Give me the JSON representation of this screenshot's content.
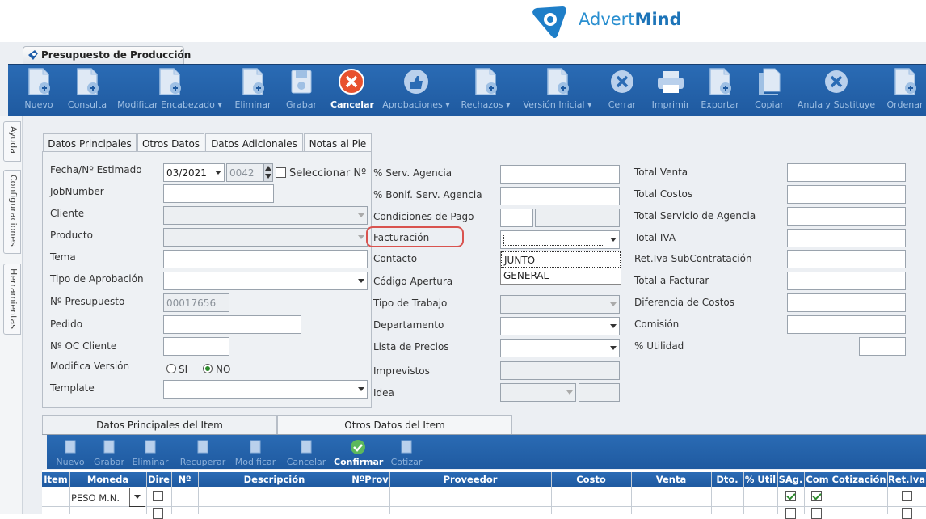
{
  "brand": {
    "name_light": "Advert",
    "name_bold": "Mind"
  },
  "document_tab": "Presupuesto de Producción",
  "toolbar": [
    {
      "icon": "new-document-icon",
      "label": "Nuevo",
      "active": false
    },
    {
      "icon": "query-document-icon",
      "label": "Consulta",
      "active": false
    },
    {
      "icon": "edit-header-icon",
      "label": "Modificar Encabezado ▾",
      "active": false
    },
    {
      "icon": "delete-document-icon",
      "label": "Eliminar",
      "active": false
    },
    {
      "icon": "save-icon",
      "label": "Grabar",
      "active": false
    },
    {
      "icon": "cancel-icon",
      "label": "Cancelar",
      "active": true
    },
    {
      "icon": "approve-icon",
      "label": "Aprobaciones ▾",
      "active": false
    },
    {
      "icon": "reject-icon",
      "label": "Rechazos ▾",
      "active": false
    },
    {
      "icon": "initial-version-icon",
      "label": "Versión Inicial ▾",
      "active": false
    },
    {
      "icon": "close-icon",
      "label": "Cerrar",
      "active": false
    },
    {
      "icon": "print-icon",
      "label": "Imprimir",
      "active": false
    },
    {
      "icon": "export-icon",
      "label": "Exportar",
      "active": false
    },
    {
      "icon": "copy-icon",
      "label": "Copiar",
      "active": false
    },
    {
      "icon": "annul-replace-icon",
      "label": "Anula y Sustituye",
      "active": false
    },
    {
      "icon": "sort-icon",
      "label": "Ordenar",
      "active": false
    }
  ],
  "side_tabs": [
    "Ayuda",
    "Configuraciones",
    "Herramientas"
  ],
  "form_tabs": [
    "Datos Principales",
    "Otros Datos",
    "Datos Adicionales",
    "Notas al Pie"
  ],
  "left_fields": {
    "fecha_label": "Fecha/Nº Estimado",
    "fecha_value": "03/2021",
    "numero_value": "0042",
    "seleccionar_label": "Seleccionar Nº",
    "jobnumber_label": "JobNumber",
    "cliente_label": "Cliente",
    "producto_label": "Producto",
    "tema_label": "Tema",
    "tipo_aprob_label": "Tipo de Aprobación",
    "presupuesto_label": "Nº Presupuesto",
    "presupuesto_value": "00017656",
    "pedido_label": "Pedido",
    "oc_label": "Nº OC Cliente",
    "modifica_label": "Modifica Versión",
    "si_label": "SI",
    "no_label": "NO",
    "template_label": "Template"
  },
  "mid_fields": {
    "serv_agencia": "% Serv. Agencia",
    "bonif": "% Bonif. Serv. Agencia",
    "condiciones": "Condiciones de Pago",
    "facturacion": "Facturación",
    "contacto": "Contacto",
    "codigo": "Código Apertura",
    "tipo_trabajo": "Tipo de Trabajo",
    "departamento": "Departamento",
    "lista_precios": "Lista de Precios",
    "imprevistos": "Imprevistos",
    "idea": "Idea"
  },
  "facturacion_options": [
    "JUNTO",
    "GENERAL"
  ],
  "right_fields": {
    "total_venta": "Total Venta",
    "total_costos": "Total Costos",
    "total_servicio": "Total Servicio de Agencia",
    "total_iva": "Total IVA",
    "ret_iva": "Ret.Iva SubContratación",
    "total_facturar": "Total a Facturar",
    "diferencia": "Diferencia de Costos",
    "comision": "Comisión",
    "utilidad": "% Utilidad"
  },
  "item_tabs": [
    "Datos Principales del Item",
    "Otros Datos del Item"
  ],
  "item_toolbar": [
    {
      "icon": "new-item-icon",
      "label": "Nuevo",
      "active": false
    },
    {
      "icon": "save-item-icon",
      "label": "Grabar",
      "active": false
    },
    {
      "icon": "delete-item-icon",
      "label": "Eliminar",
      "active": false
    },
    {
      "icon": "recover-item-icon",
      "label": "Recuperar",
      "active": false
    },
    {
      "icon": "modify-item-icon",
      "label": "Modificar",
      "active": false
    },
    {
      "icon": "cancel-item-icon",
      "label": "Cancelar",
      "active": false
    },
    {
      "icon": "confirm-icon",
      "label": "Confirmar",
      "active": true
    },
    {
      "icon": "quote-icon",
      "label": "Cotizar",
      "active": false
    }
  ],
  "grid": {
    "columns": [
      "Item",
      "Moneda",
      "Dire",
      "Nº",
      "Descripción",
      "NºProv",
      "Proveedor",
      "Costo",
      "Venta",
      "Dto.",
      "% Util",
      "SAg.",
      "Com",
      "Cotización",
      "Ret.Iva"
    ],
    "row1": {
      "moneda": "PESO M.N.",
      "sag": true,
      "com": true
    }
  }
}
